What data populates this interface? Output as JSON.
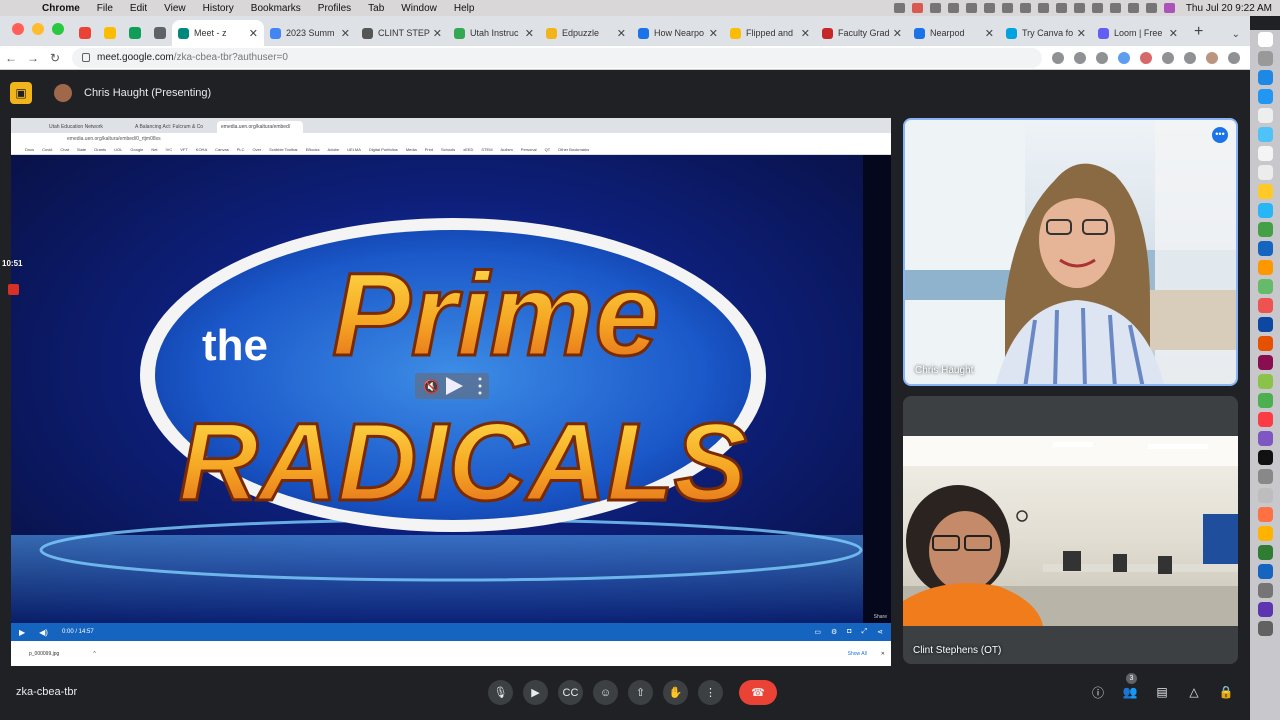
{
  "menubar": {
    "app": "Chrome",
    "items": [
      "File",
      "Edit",
      "View",
      "History",
      "Bookmarks",
      "Profiles",
      "Tab",
      "Window",
      "Help"
    ],
    "clock": "Thu Jul 20  9:22 AM"
  },
  "tabs": [
    {
      "label": "Meet - z",
      "color": "#00897b",
      "active": true
    },
    {
      "label": "2023 Summ",
      "color": "#4285f4"
    },
    {
      "label": "CLINT STEP",
      "color": "#555555"
    },
    {
      "label": "Utah Instruc",
      "color": "#34a853"
    },
    {
      "label": "Edpuzzle",
      "color": "#f2b41b"
    },
    {
      "label": "How Nearpo",
      "color": "#1a73e8"
    },
    {
      "label": "Flipped and",
      "color": "#fbbc04"
    },
    {
      "label": "Faculty Grad",
      "color": "#c62828"
    },
    {
      "label": "Nearpod",
      "color": "#1a73e8"
    },
    {
      "label": "Try Canva fo",
      "color": "#00a3e0"
    },
    {
      "label": "Loom | Free",
      "color": "#625df5"
    }
  ],
  "address": {
    "host": "meet.google.com",
    "path": "/zka-cbea-tbr?authuser=0"
  },
  "presenting": {
    "name": "Chris Haught (Presenting)"
  },
  "shared": {
    "tabs": [
      "Utah Education Network",
      "A Balancing Act: Fulcrum & Co",
      "emedia.uen.org/kaltura/embed/"
    ],
    "url": "emedia.uen.org/kaltura/embed/0_rtjm08xs",
    "bookmarks": [
      "Docs",
      "Covid",
      "Chat",
      "State",
      "Grants",
      "UOL",
      "Google",
      "Net",
      "IVC",
      "VFT",
      "KOHA",
      "Canvas",
      "PLC",
      "Over",
      "Scribble Toolbar",
      "EBooks",
      "Adobe",
      "UELMA",
      "Digital Portfolios",
      "Media",
      "Print",
      "Schools",
      "xEED",
      "STEM",
      "Autism",
      "Personal",
      "QT",
      "Other Bookmarks"
    ],
    "video_title_small": "the",
    "video_title_1": "Prime",
    "video_title_2": "RADICALS",
    "video_time": "0:00 / 14:57",
    "share_label": "Share",
    "download_file": "p_000099.jpg",
    "show_all": "Show All"
  },
  "recording": {
    "elapsed": "10:51"
  },
  "participants": [
    {
      "name": "Chris Haught"
    },
    {
      "name": "Clint Stephens (OT)"
    }
  ],
  "meeting_code": "zka-cbea-tbr",
  "people_count": "3"
}
